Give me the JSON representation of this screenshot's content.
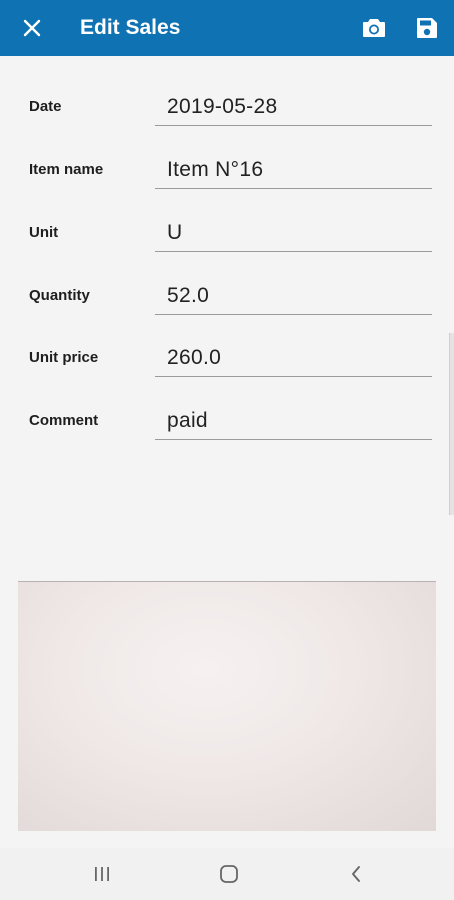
{
  "app_bar": {
    "title": "Edit Sales",
    "close_icon": "close-icon",
    "camera_icon": "camera-icon",
    "save_icon": "save-icon",
    "background_color": "#0f72b3"
  },
  "form": {
    "fields": [
      {
        "label": "Date",
        "value": "2019-05-28"
      },
      {
        "label": "Item name",
        "value": "Item N°16"
      },
      {
        "label": "Unit",
        "value": "U"
      },
      {
        "label": "Quantity",
        "value": "52.0"
      },
      {
        "label": "Unit price",
        "value": "260.0"
      },
      {
        "label": "Comment",
        "value": "paid"
      }
    ]
  },
  "photo": {
    "icon": "attached-photo"
  },
  "system_nav": {
    "recents_icon": "recents-icon",
    "home_icon": "home-icon",
    "back_icon": "back-icon"
  }
}
